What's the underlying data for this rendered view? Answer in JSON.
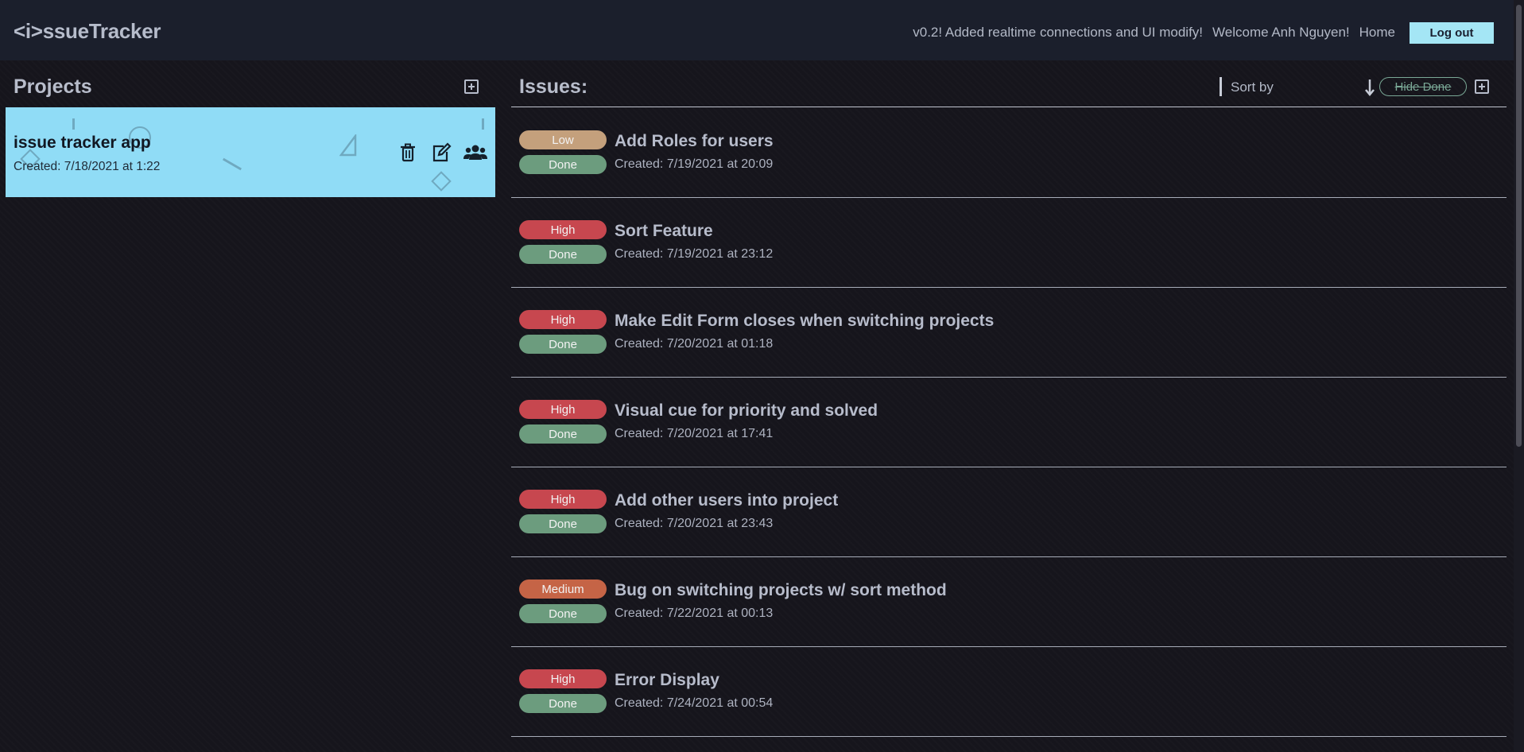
{
  "header": {
    "logo": "<i>ssueTracker",
    "version_note": "v0.2! Added realtime connections and UI modify!",
    "welcome": "Welcome Anh Nguyen!",
    "home_label": "Home",
    "logout_label": "Log out"
  },
  "projects": {
    "title": "Projects",
    "items": [
      {
        "name": "issue tracker app",
        "created": "Created: 7/18/2021 at 1:22"
      }
    ]
  },
  "issues": {
    "title": "Issues:",
    "sort_label": "Sort by",
    "hide_done_label": "Hide Done",
    "items": [
      {
        "priority": "Low",
        "priority_color": "#c4a07c",
        "status": "Done",
        "title": "Add Roles for users",
        "created": "Created: 7/19/2021 at 20:09"
      },
      {
        "priority": "High",
        "priority_color": "#c7474f",
        "status": "Done",
        "title": "Sort Feature",
        "created": "Created: 7/19/2021 at 23:12"
      },
      {
        "priority": "High",
        "priority_color": "#c7474f",
        "status": "Done",
        "title": "Make Edit Form closes when switching projects",
        "created": "Created: 7/20/2021 at 01:18"
      },
      {
        "priority": "High",
        "priority_color": "#c7474f",
        "status": "Done",
        "title": "Visual cue for priority and solved",
        "created": "Created: 7/20/2021 at 17:41"
      },
      {
        "priority": "High",
        "priority_color": "#c7474f",
        "status": "Done",
        "title": "Add other users into project",
        "created": "Created: 7/20/2021 at 23:43"
      },
      {
        "priority": "Medium",
        "priority_color": "#c56446",
        "status": "Done",
        "title": "Bug on switching projects w/ sort method",
        "created": "Created: 7/22/2021 at 00:13"
      },
      {
        "priority": "High",
        "priority_color": "#c7474f",
        "status": "Done",
        "title": "Error Display",
        "created": "Created: 7/24/2021 at 00:54"
      }
    ]
  },
  "colors": {
    "accent": "#a4e6f5",
    "project_card": "#90dcf6",
    "done": "#6c9c7e",
    "high": "#c7474f",
    "medium": "#c56446",
    "low": "#c4a07c"
  },
  "icons": [
    "plus-square-icon",
    "trash-icon",
    "edit-icon",
    "users-icon",
    "arrow-down-icon"
  ]
}
